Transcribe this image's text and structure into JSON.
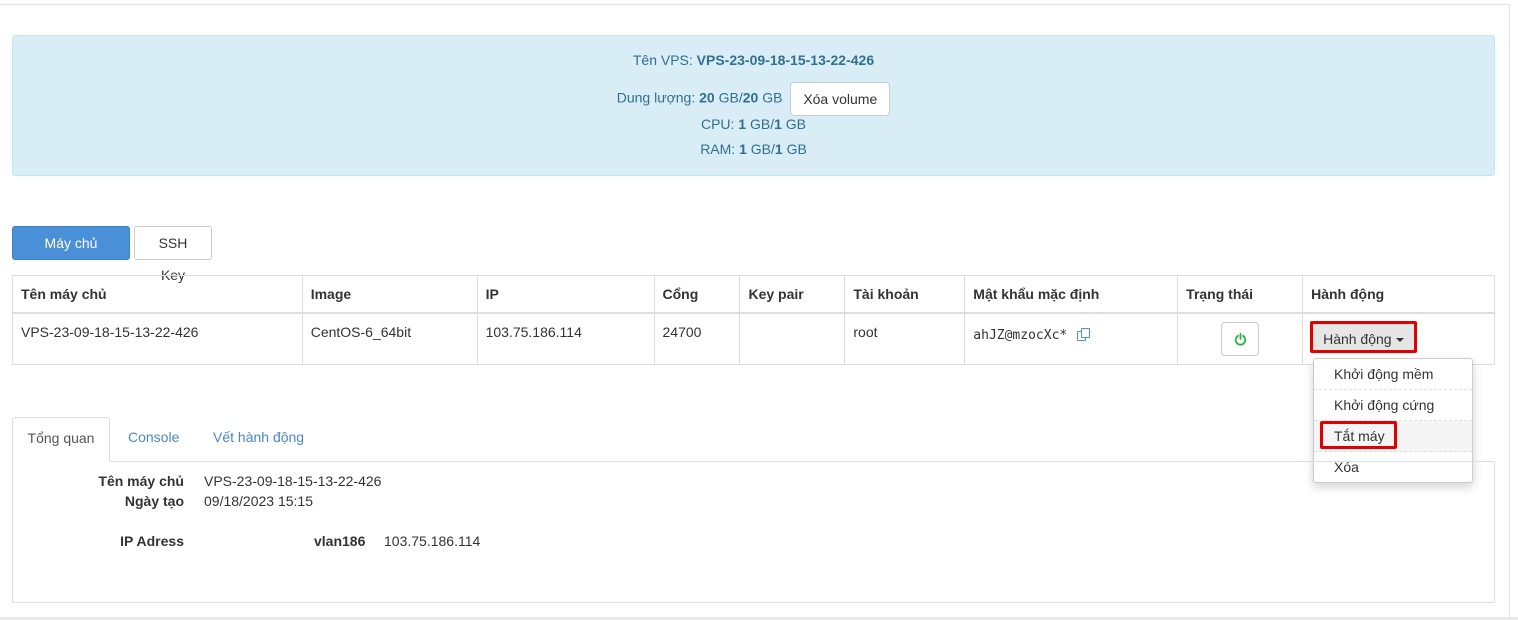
{
  "vps_info": {
    "name_label": "Tên VPS:",
    "name_value": "VPS-23-09-18-15-13-22-426",
    "storage_label": "Dung lượng:",
    "storage_used": "20",
    "storage_used_unit": "GB/",
    "storage_total": "20",
    "storage_total_unit": "GB",
    "delete_volume_button": "Xóa volume",
    "cpu_label": "CPU:",
    "cpu_used": "1",
    "cpu_used_unit": "GB/",
    "cpu_total": "1",
    "cpu_total_unit": "GB",
    "ram_label": "RAM:",
    "ram_used": "1",
    "ram_used_unit": "GB/",
    "ram_total": "1",
    "ram_total_unit": "GB"
  },
  "top_tabs": {
    "cloud_server": "Máy chủ Cloud",
    "ssh_key": "SSH Key"
  },
  "table": {
    "headers": [
      "Tên máy chủ",
      "Image",
      "IP",
      "Cổng",
      "Key pair",
      "Tài khoản",
      "Mật khẩu mặc định",
      "Trạng thái",
      "Hành động"
    ],
    "row": {
      "server_name": "VPS-23-09-18-15-13-22-426",
      "image": "CentOS-6_64bit",
      "ip": "103.75.186.114",
      "port": "24700",
      "key_pair": "",
      "account": "root",
      "default_password": "ahJZ@mzocXc*",
      "action_button": "Hành động"
    }
  },
  "action_menu": {
    "items": [
      "Khởi động mềm",
      "Khởi động cứng",
      "Tắt máy",
      "Xóa"
    ],
    "highlighted": "Tắt máy"
  },
  "detail_tabs": {
    "tabs": [
      "Tổng quan",
      "Console",
      "Vết hành động"
    ],
    "active": "Tổng quan"
  },
  "overview": {
    "server_name_label": "Tên máy chủ",
    "server_name_value": "VPS-23-09-18-15-13-22-426",
    "created_label": "Ngày tạo",
    "created_value": "09/18/2023 15:15",
    "ip_label": "IP Adress",
    "vlan_name": "vlan186",
    "vlan_ip": "103.75.186.114"
  },
  "colors": {
    "info_bg": "#d9edf7",
    "info_text": "#31708f",
    "primary": "#4a90d9",
    "highlight_red": "#e00000",
    "power_green": "#2fb344"
  }
}
